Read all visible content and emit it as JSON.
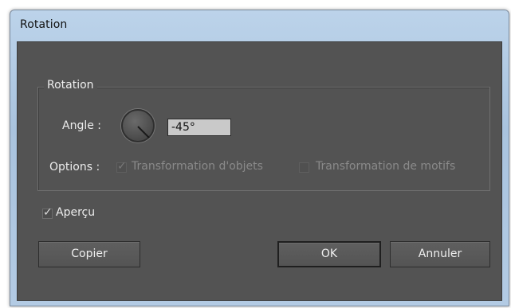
{
  "window": {
    "title": "Rotation"
  },
  "group": {
    "legend": "Rotation"
  },
  "angle": {
    "label": "Angle :",
    "value": "-45°",
    "degrees": -45
  },
  "options": {
    "label": "Options :",
    "transform_objects": {
      "label": "Transformation d'objets",
      "checked": true,
      "enabled": false
    },
    "transform_patterns": {
      "label": "Transformation de motifs",
      "checked": false,
      "enabled": false
    }
  },
  "preview": {
    "label": "Aperçu",
    "checked": true
  },
  "buttons": {
    "copy": "Copier",
    "ok": "OK",
    "cancel": "Annuler"
  }
}
